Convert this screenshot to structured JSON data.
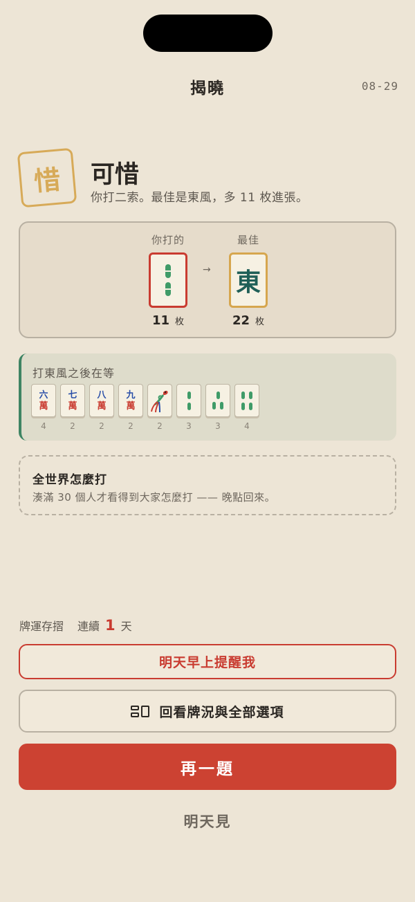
{
  "header": {
    "title": "揭曉",
    "date": "08-29"
  },
  "verdict": {
    "stamp": "惜",
    "title": "可惜",
    "subtitle": "你打二索。最佳是東風，多 11 枚進張。"
  },
  "compare": {
    "yours": {
      "label": "你打的",
      "count": "11",
      "unit": "枚",
      "tile": "二索"
    },
    "arrow": "→",
    "best": {
      "label": "最佳",
      "count": "22",
      "unit": "枚",
      "tile": "東"
    }
  },
  "wait": {
    "title": "打東風之後在等",
    "tiles": [
      {
        "top": "六",
        "bottom": "萬",
        "count": "4",
        "kind": "wan"
      },
      {
        "top": "七",
        "bottom": "萬",
        "count": "2",
        "kind": "wan"
      },
      {
        "top": "八",
        "bottom": "萬",
        "count": "2",
        "kind": "wan"
      },
      {
        "top": "九",
        "bottom": "萬",
        "count": "2",
        "kind": "wan"
      },
      {
        "name": "一索",
        "count": "2",
        "kind": "bird"
      },
      {
        "name": "二索",
        "count": "3",
        "kind": "sou2"
      },
      {
        "name": "三索",
        "count": "3",
        "kind": "sou3"
      },
      {
        "name": "四索",
        "count": "4",
        "kind": "sou4"
      }
    ]
  },
  "world": {
    "title": "全世界怎麼打",
    "subtitle": "湊滿 30 個人才看得到大家怎麼打 —— 晚點回來。"
  },
  "streak": {
    "label": "牌運存摺",
    "prefix": "連續",
    "count": "1",
    "suffix": "天"
  },
  "buttons": {
    "remind": "明天早上提醒我",
    "review": "回看牌況與全部選項",
    "next": "再一題",
    "see_you": "明天見"
  },
  "colors": {
    "accent": "#cc4232",
    "gold": "#d7aa58",
    "green": "#3f9b68",
    "background": "#ede5d6"
  }
}
